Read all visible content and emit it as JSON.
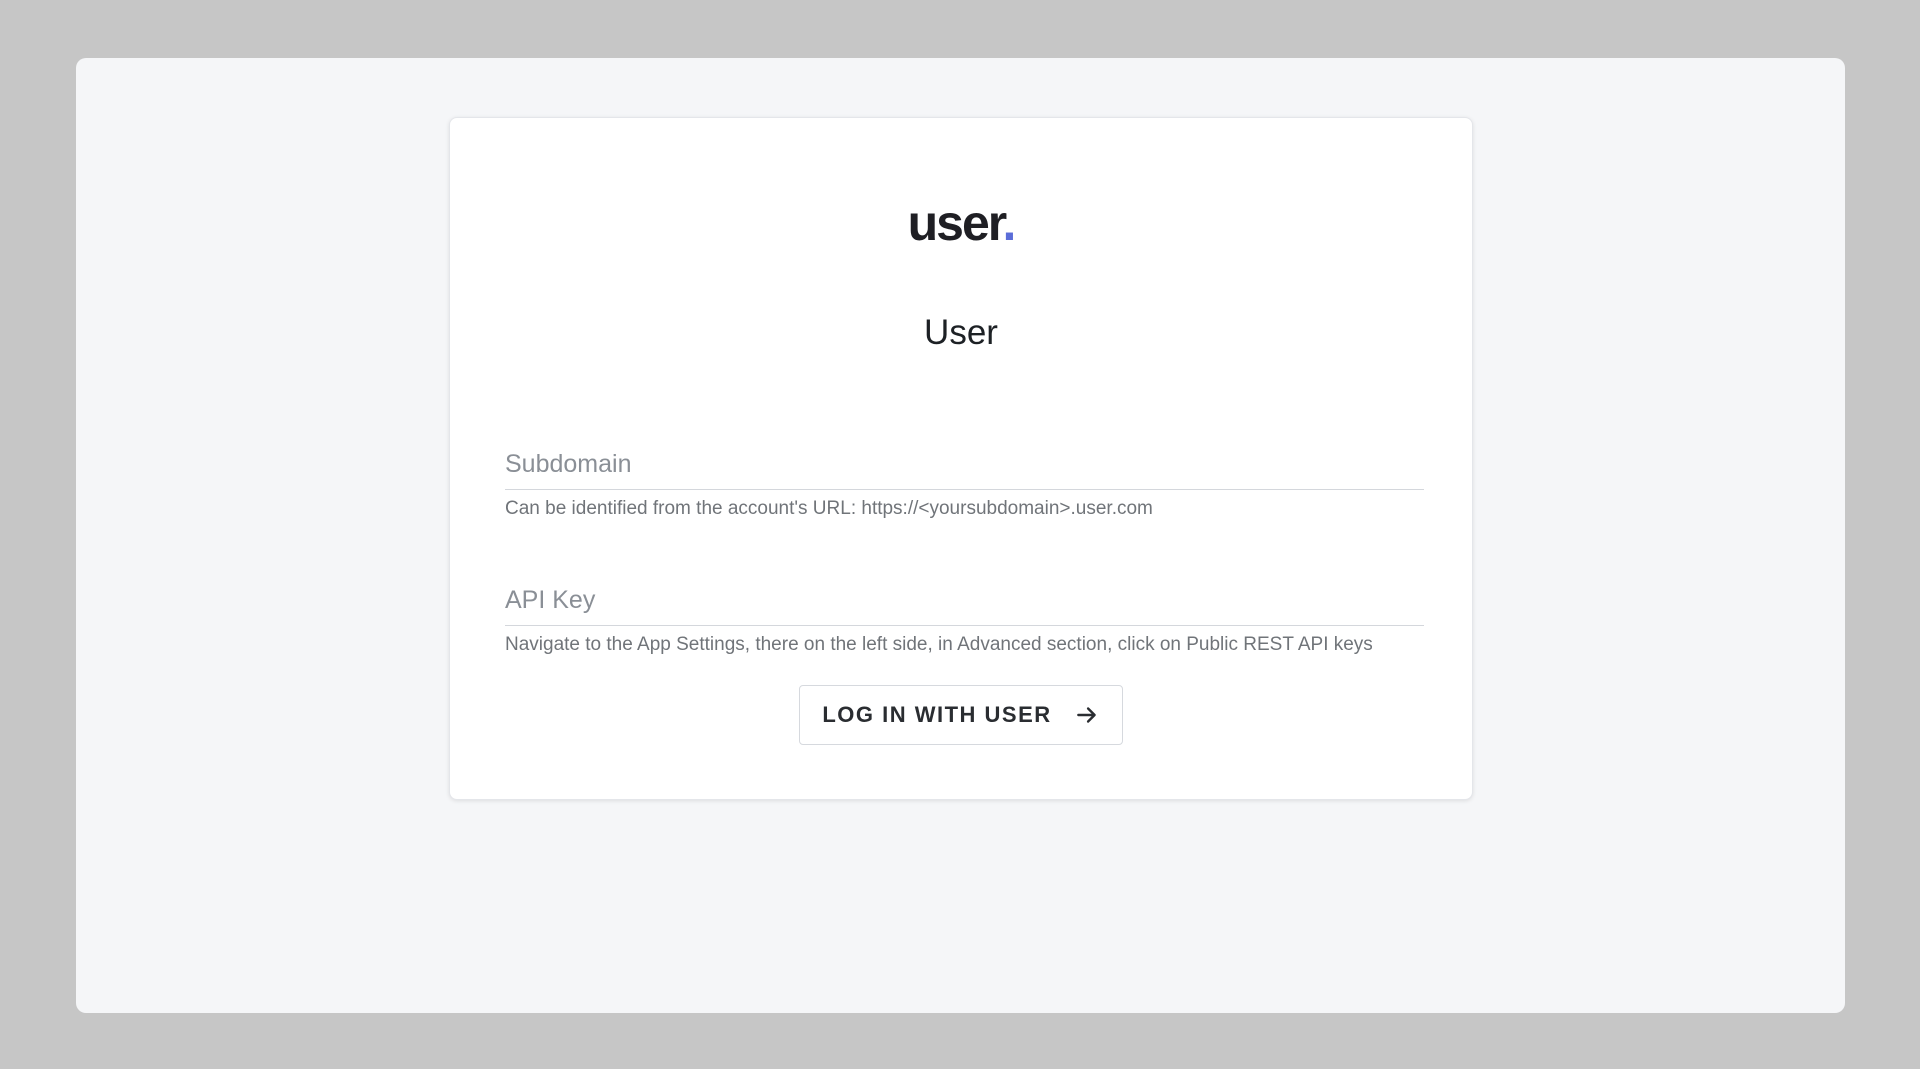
{
  "logo": {
    "text": "user",
    "dot": ".",
    "dot_color": "#5b6dd8"
  },
  "title": "User",
  "subdomain": {
    "placeholder": "Subdomain",
    "value": "",
    "helper": "Can be identified from the account's URL: https://<yoursubdomain>.user.com"
  },
  "api_key": {
    "placeholder": "API Key",
    "value": "",
    "helper": "Navigate to the App Settings, there on the left side, in Advanced section, click on Public REST API keys"
  },
  "login_button": {
    "label": "LOG IN WITH USER",
    "icon": "arrow-right-icon"
  }
}
